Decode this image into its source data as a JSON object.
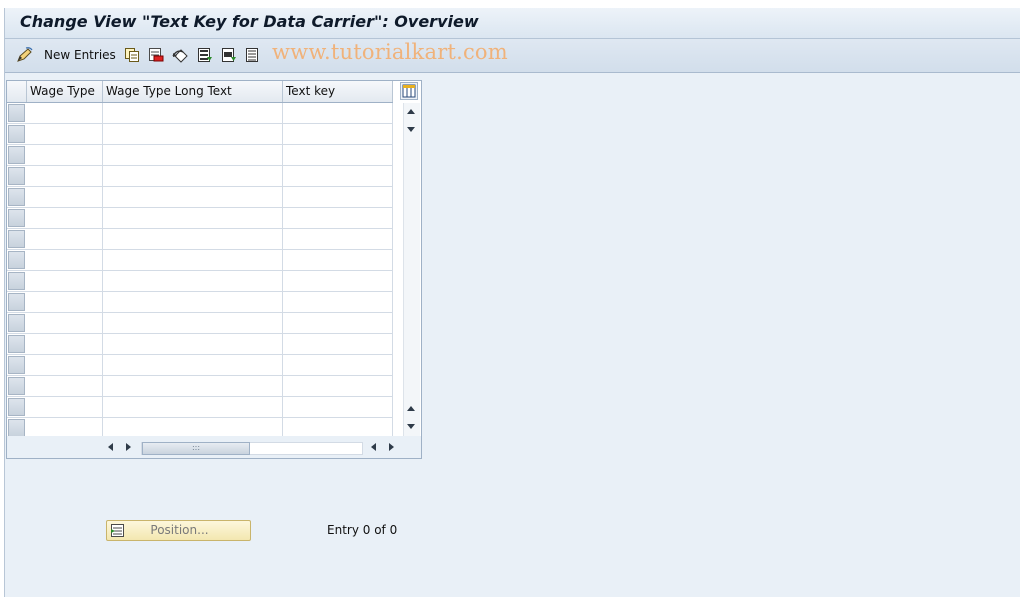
{
  "window": {
    "title": "Change View \"Text Key for Data Carrier\": Overview"
  },
  "toolbar": {
    "new_entries_label": "New Entries",
    "watermark": "www.tutorialkart.com",
    "icons": [
      "edit-pencil-icon",
      "copy-icon",
      "delete-icon",
      "undo-icon",
      "select-all-icon",
      "select-block-icon",
      "deselect-all-icon"
    ]
  },
  "table": {
    "columns": [
      "Wage Type",
      "Wage Type Long Text",
      "Text key"
    ],
    "row_count": 16,
    "rows": []
  },
  "footer": {
    "position_button_label": "Position...",
    "entry_info": "Entry 0 of 0"
  },
  "colors": {
    "title_bar": "#dbe6f1",
    "background": "#e9f0f7",
    "position_button": "#f3e7b0",
    "watermark": "#f0b27a"
  }
}
